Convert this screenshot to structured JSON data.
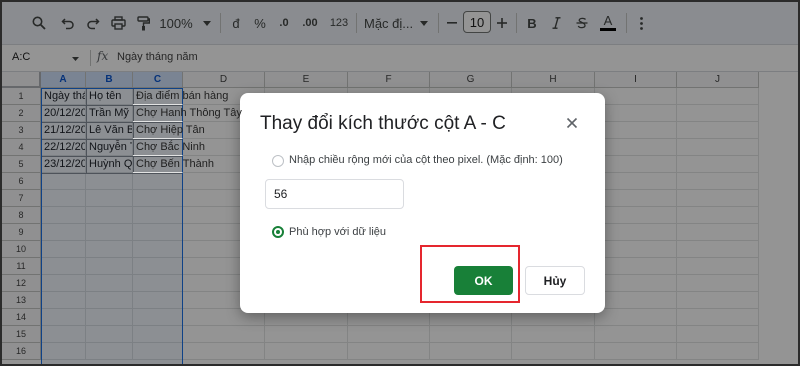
{
  "toolbar": {
    "zoom": "100%",
    "currency": "đ",
    "percent": "%",
    "decrease_decimal": ".0",
    "increase_decimal": ".00",
    "number_format": "123",
    "font_name": "Mặc đị...",
    "font_size": "10",
    "bold": "B",
    "text_color": "A"
  },
  "formula_bar": {
    "name_box": "A:C",
    "fx": "fx",
    "content": "Ngày tháng năm"
  },
  "grid": {
    "columns": [
      "A",
      "B",
      "C",
      "D",
      "E",
      "F",
      "G",
      "H",
      "I",
      "J"
    ],
    "rows": [
      "1",
      "2",
      "3",
      "4",
      "5",
      "6",
      "7",
      "8",
      "9",
      "10",
      "11",
      "12",
      "13",
      "14",
      "15",
      "16"
    ],
    "data": [
      [
        "Ngày thá",
        "Họ tên",
        "Địa điểm bán hàng"
      ],
      [
        "20/12/20",
        "Trần Mỹ",
        "Chợ Hanh Thông Tây"
      ],
      [
        "21/12/20",
        "Lê Văn B",
        "Chợ Hiệp Tân"
      ],
      [
        "22/12/20",
        "Nguyễn T",
        "Chợ Bắc Ninh"
      ],
      [
        "23/12/20",
        "Huỳnh Q",
        "Chợ Bến Thành"
      ]
    ]
  },
  "dialog": {
    "title": "Thay đổi kích thước cột A - C",
    "option_pixel_label": "Nhập chiều rộng mới của cột theo pixel. (Mặc định: 100)",
    "width_value": "56",
    "option_fit_label": "Phù hợp với dữ liệu",
    "ok_label": "OK",
    "cancel_label": "Hủy"
  },
  "colors": {
    "accent_green": "#188038",
    "highlight_red": "#e5262e",
    "selection_blue": "#1a73e8"
  }
}
